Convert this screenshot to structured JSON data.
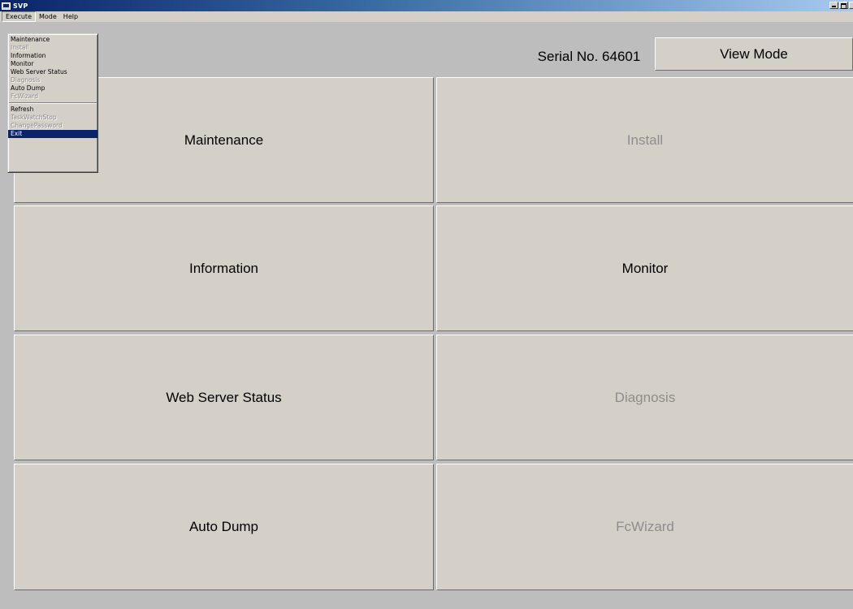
{
  "window": {
    "title": "SVP",
    "menu": [
      "Execute",
      "Mode",
      "Help"
    ]
  },
  "header": {
    "serial": "Serial No. 64601",
    "view_mode": "View Mode"
  },
  "tiles": {
    "maintenance": "Maintenance",
    "install": "Install",
    "information": "Information",
    "monitor": "Monitor",
    "web_server_status": "Web Server Status",
    "diagnosis": "Diagnosis",
    "auto_dump": "Auto Dump",
    "fcwizard": "FcWizard"
  },
  "dropdown": {
    "group1": [
      {
        "label": "Maintenance",
        "enabled": true
      },
      {
        "label": "Install",
        "enabled": false
      },
      {
        "label": "Information",
        "enabled": true
      },
      {
        "label": "Monitor",
        "enabled": true
      },
      {
        "label": "Web Server Status",
        "enabled": true
      },
      {
        "label": "Diagnosis",
        "enabled": false
      },
      {
        "label": "Auto Dump",
        "enabled": true
      },
      {
        "label": "FcWizard",
        "enabled": false
      }
    ],
    "group2": [
      {
        "label": "Refresh",
        "enabled": true
      },
      {
        "label": "TaskWatchStop",
        "enabled": false
      },
      {
        "label": "ChangePassword",
        "enabled": false
      },
      {
        "label": "Exit",
        "enabled": true,
        "selected": true
      }
    ]
  },
  "colors": {
    "title_start": "#0a246a",
    "title_end": "#a6caf0",
    "face": "#d4d0c8",
    "background": "#bdbdbd",
    "highlight": "#0a246a",
    "disabled_text": "#8d8d8d"
  }
}
